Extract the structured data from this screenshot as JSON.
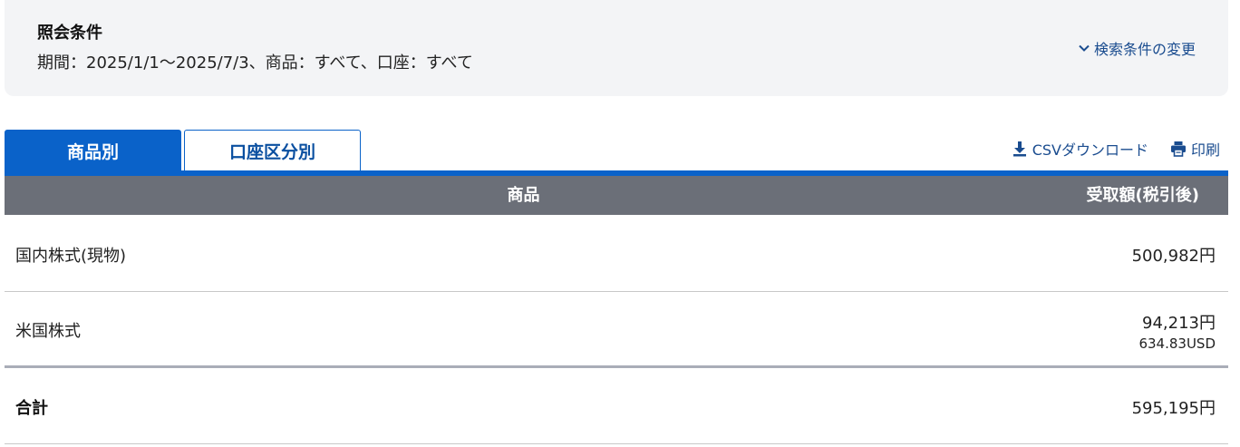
{
  "conditions": {
    "title": "照会条件",
    "text": "期間：2025/1/1～2025/7/3、商品：すべて、口座：すべて",
    "change_label": "検索条件の変更",
    "change_icon": "chevron-down-icon"
  },
  "tabs": [
    {
      "label": "商品別",
      "active": true
    },
    {
      "label": "口座区分別",
      "active": false
    }
  ],
  "actions": {
    "csv_label": "CSVダウンロード",
    "csv_icon": "download-icon",
    "print_label": "印刷",
    "print_icon": "printer-icon"
  },
  "table": {
    "headers": {
      "product": "商品",
      "amount": "受取額(税引後)"
    },
    "rows": [
      {
        "product": "国内株式(現物)",
        "amount": "500,982円"
      },
      {
        "product": "米国株式",
        "amount": "94,213円",
        "sub_amount": "634.83USD"
      }
    ],
    "total": {
      "label": "合計",
      "amount": "595,195円"
    }
  },
  "colors": {
    "accent": "#0a62c9",
    "link": "#1a4c8f",
    "header_bg": "#6b6f78",
    "condition_bg": "#f3f4f6"
  }
}
